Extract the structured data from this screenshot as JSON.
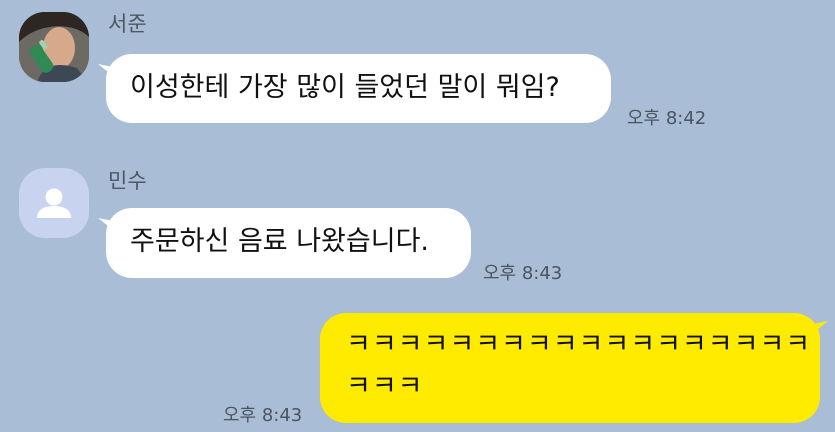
{
  "messages": [
    {
      "sender": "서준",
      "text": "이성한테 가장 많이 들었던 말이 뭐임?",
      "time": "오후 8:42"
    },
    {
      "sender": "민수",
      "text": "주문하신 음료 나왔습니다.",
      "time": "오후 8:43"
    },
    {
      "text_line1": "ㅋㅋㅋㅋㅋㅋㅋㅋㅋㅋㅋㅋㅋㅋㅋㅋㅋㅋ",
      "text_line2": "ㅋㅋㅋ",
      "time": "오후 8:43"
    }
  ],
  "colors": {
    "background": "#a9bed6",
    "incoming_bubble": "#ffffff",
    "outgoing_bubble": "#ffeb00",
    "default_avatar": "#c8d3ef"
  },
  "icons": {
    "default_avatar": "person-icon"
  }
}
